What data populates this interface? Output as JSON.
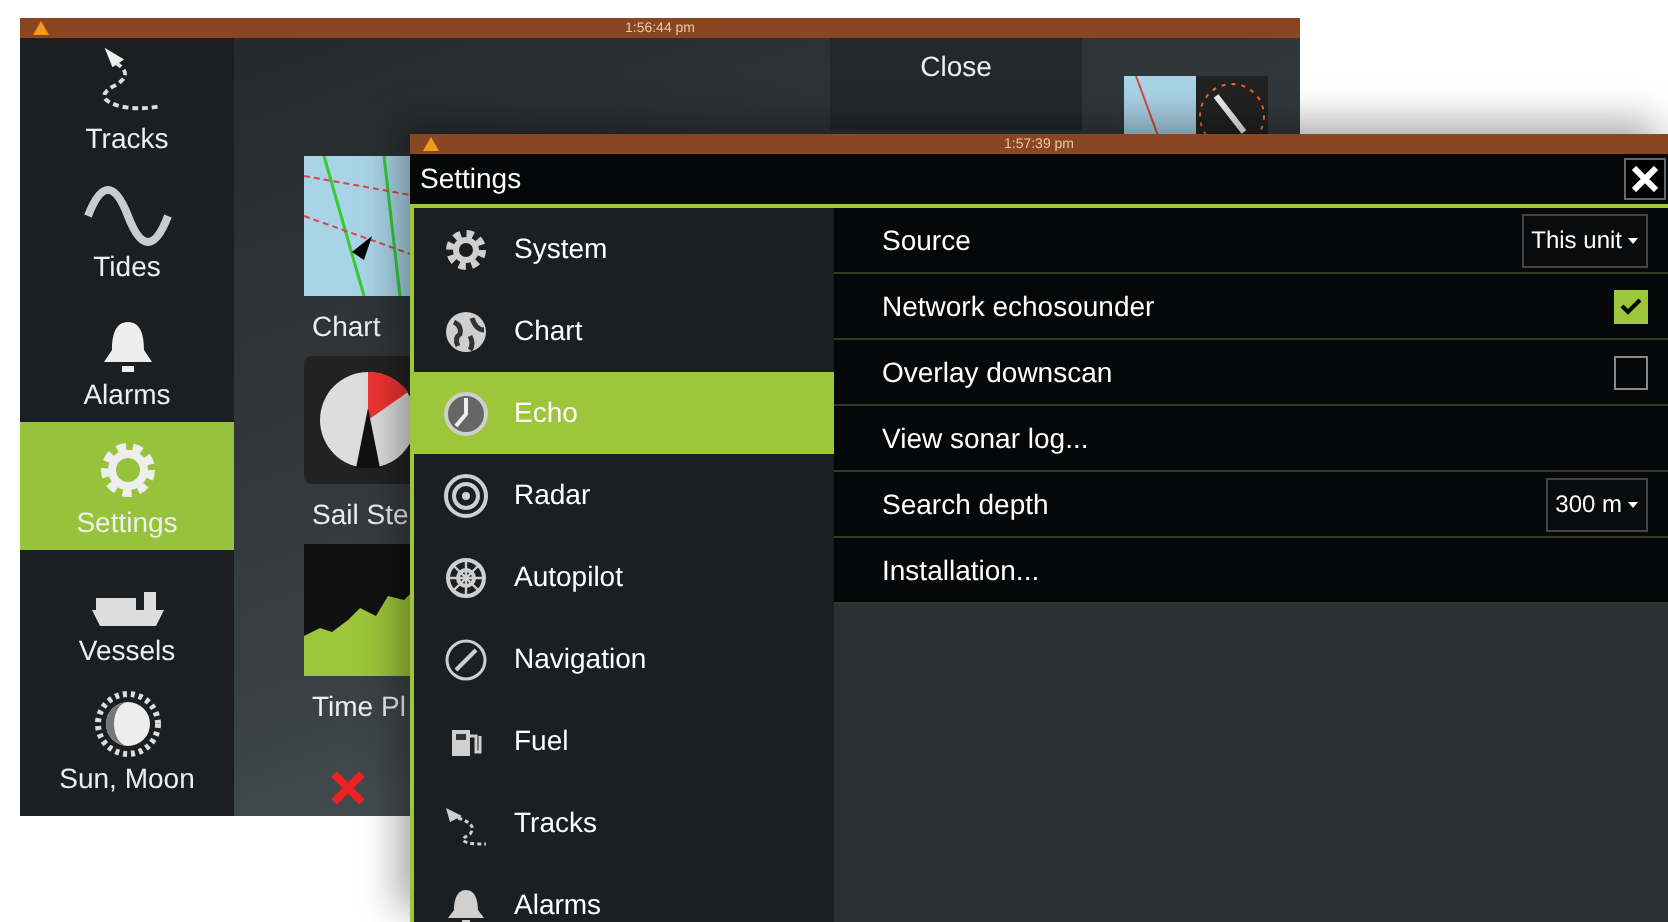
{
  "back_screen": {
    "status_bar": {
      "time": "1:56:44 pm"
    },
    "sidebar": {
      "items": [
        {
          "kind": "tracks",
          "label": "Tracks",
          "selected": false
        },
        {
          "kind": "tides",
          "label": "Tides",
          "selected": false
        },
        {
          "kind": "alarms",
          "label": "Alarms",
          "selected": false
        },
        {
          "kind": "settings",
          "label": "Settings",
          "selected": true
        },
        {
          "kind": "vessels",
          "label": "Vessels",
          "selected": false
        },
        {
          "kind": "sun_moon",
          "label": "Sun, Moon",
          "selected": false
        }
      ]
    },
    "tiles": [
      {
        "kind": "chart",
        "label": "Chart"
      },
      {
        "kind": "gauge",
        "label": "Sail Ste"
      },
      {
        "kind": "plot",
        "label": "Time Pl"
      }
    ],
    "close_button": {
      "label": "Close"
    }
  },
  "front_screen": {
    "status_bar": {
      "time": "1:57:39 pm"
    },
    "window": {
      "title": "Settings"
    },
    "menu": {
      "items": [
        {
          "kind": "system",
          "label": "System",
          "selected": false
        },
        {
          "kind": "chart",
          "label": "Chart",
          "selected": false
        },
        {
          "kind": "echo",
          "label": "Echo",
          "selected": true
        },
        {
          "kind": "radar",
          "label": "Radar",
          "selected": false
        },
        {
          "kind": "autopilot",
          "label": "Autopilot",
          "selected": false
        },
        {
          "kind": "navigation",
          "label": "Navigation",
          "selected": false
        },
        {
          "kind": "fuel",
          "label": "Fuel",
          "selected": false
        },
        {
          "kind": "tracks",
          "label": "Tracks",
          "selected": false
        },
        {
          "kind": "alarms",
          "label": "Alarms",
          "selected": false
        }
      ]
    },
    "settings": [
      {
        "kind": "dropdown",
        "label": "Source",
        "value": "This unit"
      },
      {
        "kind": "checkbox",
        "label": "Network echosounder",
        "checked": true
      },
      {
        "kind": "checkbox",
        "label": "Overlay downscan",
        "checked": false
      },
      {
        "kind": "action",
        "label": "View sonar log..."
      },
      {
        "kind": "dropdown",
        "label": "Search depth",
        "value": "300 m"
      },
      {
        "kind": "action",
        "label": "Installation..."
      }
    ]
  }
}
